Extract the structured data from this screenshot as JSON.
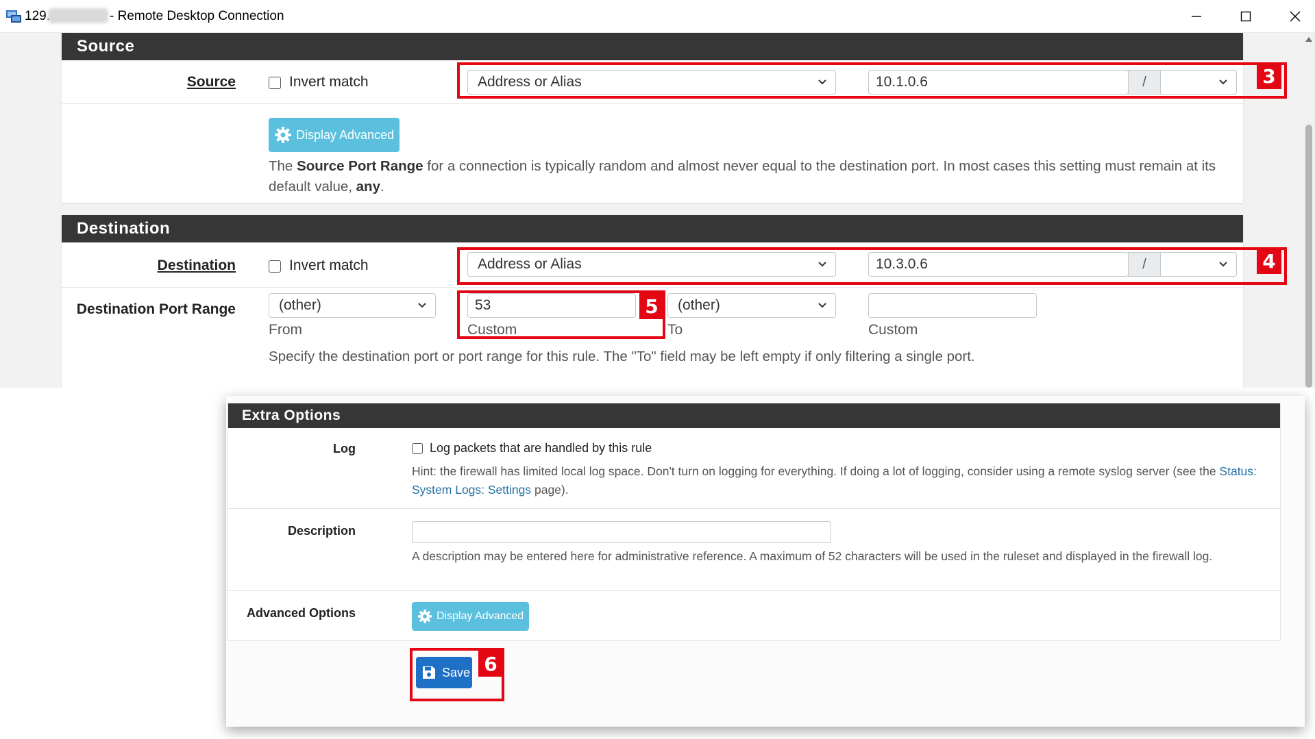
{
  "window": {
    "host_prefix": "129.",
    "title": "- Remote Desktop Connection"
  },
  "source": {
    "header": "Source",
    "label": "Source",
    "invert_label": "Invert match",
    "type_value": "Address or Alias",
    "address_value": "10.1.0.6",
    "slash": "/",
    "mask_value": "",
    "display_advanced": "Display Advanced",
    "help_prefix": "The ",
    "help_bold": "Source Port Range",
    "help_middle": " for a connection is typically random and almost never equal to the destination port. In most cases this setting must remain at its default value, ",
    "help_any": "any",
    "help_end": "."
  },
  "destination": {
    "header": "Destination",
    "label": "Destination",
    "invert_label": "Invert match",
    "type_value": "Address or Alias",
    "address_value": "10.3.0.6",
    "slash": "/",
    "mask_value": "",
    "port_range_label": "Destination Port Range",
    "from_select": "(other)",
    "from_custom_value": "53",
    "to_select": "(other)",
    "to_custom_value": "",
    "sub_from": "From",
    "sub_custom_1": "Custom",
    "sub_to": "To",
    "sub_custom_2": "Custom",
    "help": "Specify the destination port or port range for this rule. The \"To\" field may be left empty if only filtering a single port."
  },
  "extra": {
    "header": "Extra Options",
    "log_label": "Log",
    "log_checkbox_label": "Log packets that are handled by this rule",
    "log_hint_a": "Hint: the firewall has limited local log space. Don't turn on logging for everything. If doing a lot of logging, consider using a remote syslog server (see the ",
    "log_hint_link": "Status: System Logs: Settings",
    "log_hint_b": " page).",
    "description_label": "Description",
    "description_value": "",
    "description_help": "A description may be entered here for administrative reference. A maximum of 52 characters will be used in the ruleset and displayed in the firewall log.",
    "advanced_label": "Advanced Options",
    "display_advanced": "Display Advanced",
    "save": "Save"
  },
  "annotations": {
    "b3": "3",
    "b4": "4",
    "b5": "5",
    "b6": "6"
  },
  "colors": {
    "panel_header": "#363636",
    "info_button": "#5bc0de",
    "primary_button": "#1e6fc6",
    "annotation_red": "#e30613",
    "link": "#2471a3"
  },
  "icons": {
    "app": "remote-desktop-icon",
    "minimize": "minimize-icon",
    "maximize": "maximize-icon",
    "close": "close-icon",
    "gear": "gear-icon",
    "save": "floppy-disk-icon",
    "chevron": "chevron-down-icon"
  }
}
